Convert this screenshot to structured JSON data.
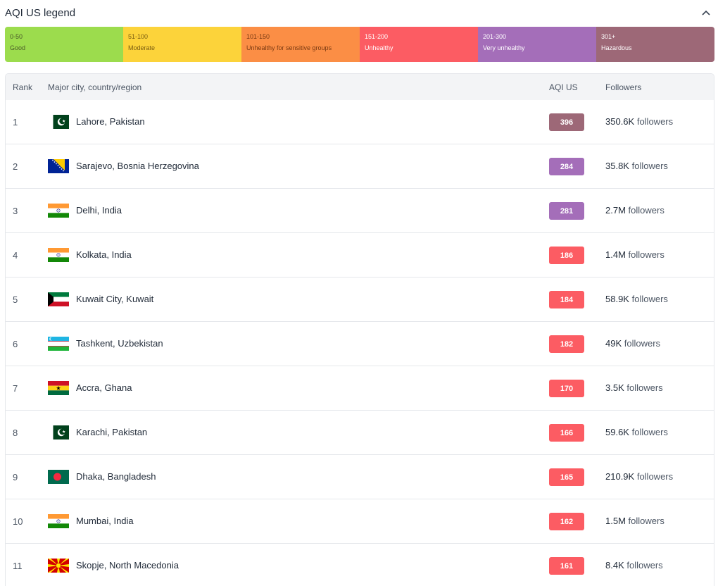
{
  "legend": {
    "title": "AQI US legend",
    "segments": [
      {
        "range": "0-50",
        "label": "Good",
        "color": "#9cdc4d",
        "text_color": "#4b5a2a"
      },
      {
        "range": "51-100",
        "label": "Moderate",
        "color": "#fcd33a",
        "text_color": "#7a5d12"
      },
      {
        "range": "101-150",
        "label": "Unhealthy for sensitive groups",
        "color": "#fb8e45",
        "text_color": "#7a3a12"
      },
      {
        "range": "151-200",
        "label": "Unhealthy",
        "color": "#fc5c63",
        "text_color": "#ffffff"
      },
      {
        "range": "201-300",
        "label": "Very unhealthy",
        "color": "#a46eb9",
        "text_color": "#ffffff"
      },
      {
        "range": "301+",
        "label": "Hazardous",
        "color": "#9d6877",
        "text_color": "#ffffff"
      }
    ]
  },
  "table": {
    "headers": {
      "rank": "Rank",
      "city": "Major city, country/region",
      "aqi": "AQI US",
      "followers": "Followers"
    },
    "followers_suffix": "followers",
    "rows": [
      {
        "rank": "1",
        "flag": "pakistan",
        "city": "Lahore, Pakistan",
        "aqi": "396",
        "aqi_color": "#9d6877",
        "followers": "350.6K"
      },
      {
        "rank": "2",
        "flag": "bosnia",
        "city": "Sarajevo, Bosnia Herzegovina",
        "aqi": "284",
        "aqi_color": "#a46eb9",
        "followers": "35.8K"
      },
      {
        "rank": "3",
        "flag": "india",
        "city": "Delhi, India",
        "aqi": "281",
        "aqi_color": "#a46eb9",
        "followers": "2.7M"
      },
      {
        "rank": "4",
        "flag": "india",
        "city": "Kolkata, India",
        "aqi": "186",
        "aqi_color": "#fc5c63",
        "followers": "1.4M"
      },
      {
        "rank": "5",
        "flag": "kuwait",
        "city": "Kuwait City, Kuwait",
        "aqi": "184",
        "aqi_color": "#fc5c63",
        "followers": "58.9K"
      },
      {
        "rank": "6",
        "flag": "uzbekistan",
        "city": "Tashkent, Uzbekistan",
        "aqi": "182",
        "aqi_color": "#fc5c63",
        "followers": "49K"
      },
      {
        "rank": "7",
        "flag": "ghana",
        "city": "Accra, Ghana",
        "aqi": "170",
        "aqi_color": "#fc5c63",
        "followers": "3.5K"
      },
      {
        "rank": "8",
        "flag": "pakistan",
        "city": "Karachi, Pakistan",
        "aqi": "166",
        "aqi_color": "#fc5c63",
        "followers": "59.6K"
      },
      {
        "rank": "9",
        "flag": "bangladesh",
        "city": "Dhaka, Bangladesh",
        "aqi": "165",
        "aqi_color": "#fc5c63",
        "followers": "210.9K"
      },
      {
        "rank": "10",
        "flag": "india",
        "city": "Mumbai, India",
        "aqi": "162",
        "aqi_color": "#fc5c63",
        "followers": "1.5M"
      },
      {
        "rank": "11",
        "flag": "macedonia",
        "city": "Skopje, North Macedonia",
        "aqi": "161",
        "aqi_color": "#fc5c63",
        "followers": "8.4K"
      }
    ]
  }
}
